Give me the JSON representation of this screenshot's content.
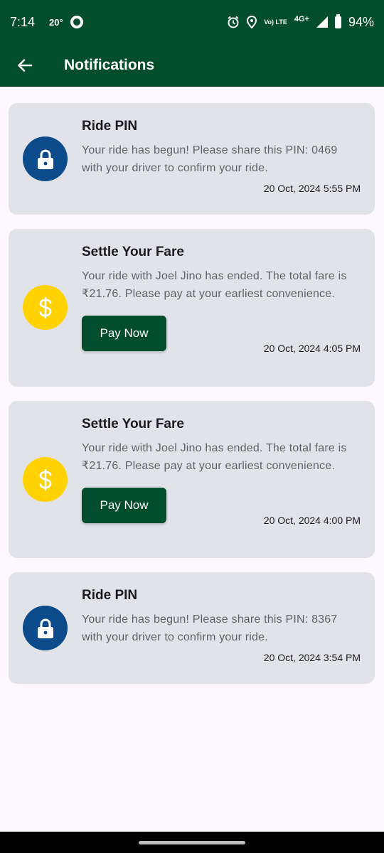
{
  "status_bar": {
    "time": "7:14",
    "temperature": "20°",
    "network_label": "4G+",
    "volte_label": "Vo) LTE",
    "battery": "94%"
  },
  "app_bar": {
    "title": "Notifications",
    "back_icon": "arrow-left-icon"
  },
  "notifications": [
    {
      "type": "ride-pin",
      "icon": "lock-icon",
      "title": "Ride PIN",
      "body": "Your ride has begun! Please share this PIN: 0469 with your driver to confirm your ride.",
      "time": "20 Oct, 2024 5:55 PM"
    },
    {
      "type": "fare",
      "icon": "dollar-icon",
      "title": "Settle Your Fare",
      "body": "Your ride with Joel Jino has ended. The total fare is ₹21.76. Please pay at your earliest convenience.",
      "button": "Pay Now",
      "time": "20 Oct, 2024 4:05 PM"
    },
    {
      "type": "fare",
      "icon": "dollar-icon",
      "title": "Settle Your Fare",
      "body": "Your ride with Joel Jino has ended. The total fare is ₹21.76. Please pay at your earliest convenience.",
      "button": "Pay Now",
      "time": "20 Oct, 2024 4:00 PM"
    },
    {
      "type": "ride-pin",
      "icon": "lock-icon",
      "title": "Ride PIN",
      "body": "Your ride has begun! Please share this PIN: 8367 with your driver to confirm your ride.",
      "time": "20 Oct, 2024 3:54 PM"
    }
  ],
  "colors": {
    "primary": "#024D2B",
    "pin_icon_bg": "#0B4A8B",
    "fare_icon_bg": "#FFD200",
    "card_bg": "#E2E3E8"
  }
}
